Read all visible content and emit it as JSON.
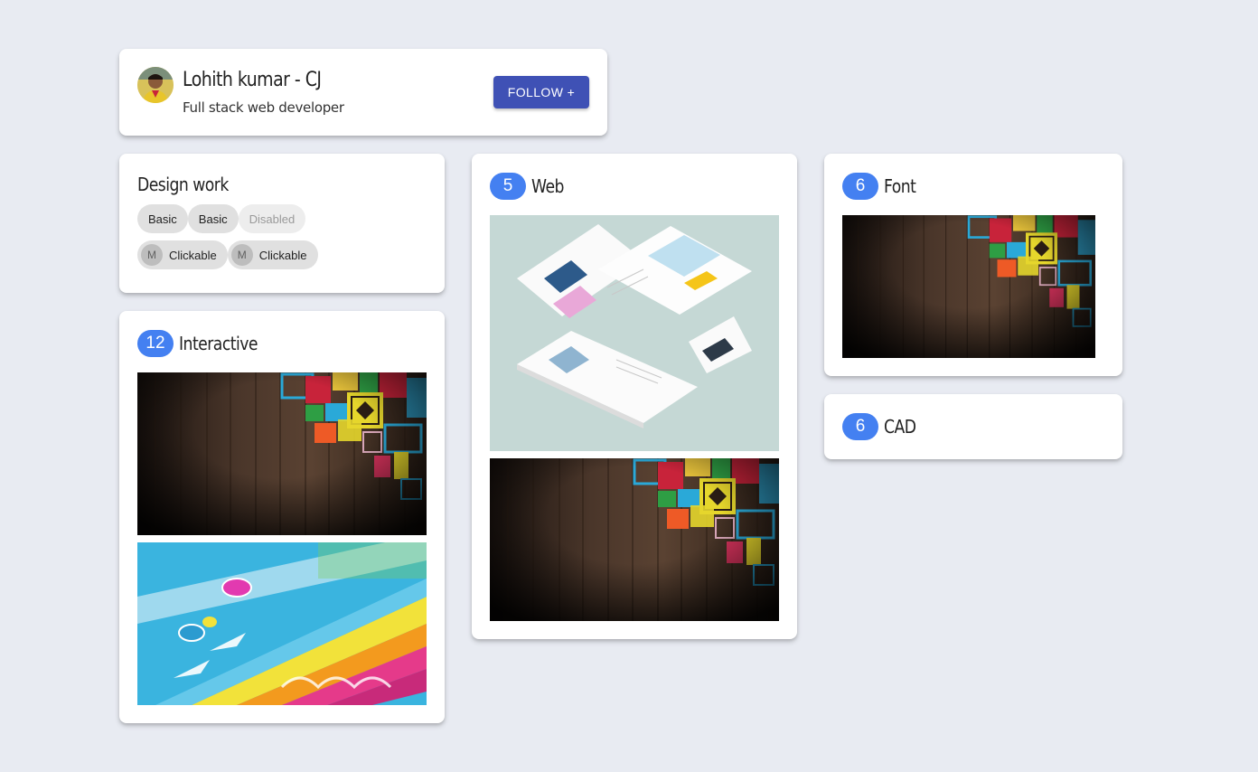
{
  "profile": {
    "name": "Lohith kumar - CJ",
    "role": "Full stack web developer",
    "follow_label": "FOLLOW +"
  },
  "design_work": {
    "title": "Design work",
    "chips": [
      {
        "label": "Basic",
        "state": "default"
      },
      {
        "label": "Basic",
        "state": "default"
      },
      {
        "label": "Disabled",
        "state": "disabled"
      }
    ],
    "clickable_chips": [
      {
        "avatar_letter": "M",
        "label": "Clickable"
      },
      {
        "avatar_letter": "M",
        "label": "Clickable"
      }
    ]
  },
  "categories": {
    "interactive": {
      "count": "12",
      "title": "Interactive"
    },
    "web": {
      "count": "5",
      "title": "Web"
    },
    "font": {
      "count": "6",
      "title": "Font"
    },
    "cad": {
      "count": "6",
      "title": "CAD"
    }
  },
  "colors": {
    "background": "#e8ebf2",
    "badge": "#4480f1",
    "follow_button": "#3f51b5"
  }
}
